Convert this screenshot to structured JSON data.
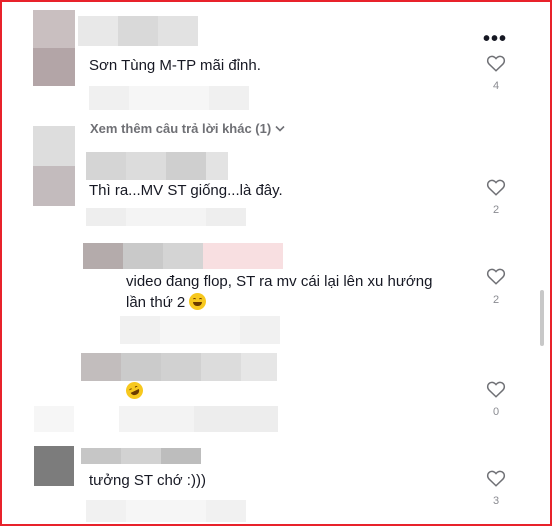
{
  "menu_icon": "more-horizontal-icon",
  "comments": [
    {
      "text": "Sơn Tùng M-TP mãi đỉnh.",
      "likes": "4"
    },
    {
      "text": "Thì ra...MV ST giống...là đây.",
      "likes": "2"
    },
    {
      "text_line1": "video đang flop, ST ra mv cái lại lên xu hướng",
      "text_line2": "lần thứ 2",
      "likes": "2",
      "emoji": "grinning-squint-emoji"
    },
    {
      "emoji": "rolling-laughing-emoji",
      "likes": "0"
    },
    {
      "text": "tưởng ST chớ :)))",
      "likes": "3"
    }
  ],
  "more_replies_label": "Xem thêm câu trả lời khác (1)",
  "heart_icon": "heart-outline-icon",
  "chevron_icon": "chevron-down-icon"
}
